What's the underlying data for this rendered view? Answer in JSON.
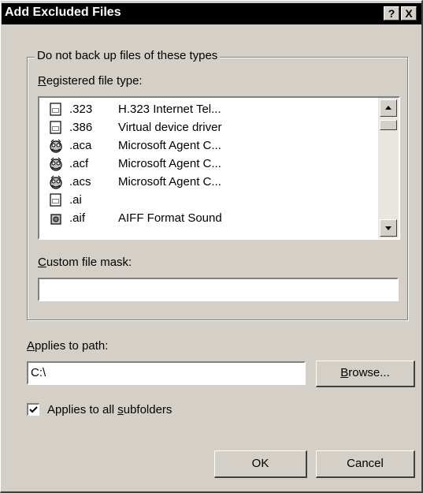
{
  "window": {
    "title": "Add Excluded Files",
    "help_label": "?",
    "close_label": "X"
  },
  "group": {
    "label": "Do not back up files of these types"
  },
  "registered": {
    "label_prefix": "",
    "label_accel": "R",
    "label_rest": "egistered file type:",
    "items": [
      {
        "ext": ".323",
        "desc": "H.323 Internet Tel...",
        "icon": "document-icon"
      },
      {
        "ext": ".386",
        "desc": "Virtual device driver",
        "icon": "document-icon"
      },
      {
        "ext": ".aca",
        "desc": "Microsoft Agent C...",
        "icon": "agent-icon"
      },
      {
        "ext": ".acf",
        "desc": "Microsoft Agent C...",
        "icon": "agent-icon"
      },
      {
        "ext": ".acs",
        "desc": "Microsoft Agent C...",
        "icon": "agent-icon"
      },
      {
        "ext": ".ai",
        "desc": "",
        "icon": "document-icon"
      },
      {
        "ext": ".aif",
        "desc": "AIFF Format Sound",
        "icon": "sound-icon"
      }
    ]
  },
  "custom_mask": {
    "label_accel": "C",
    "label_rest": "ustom file mask:",
    "value": ""
  },
  "path": {
    "label_accel": "A",
    "label_rest": "pplies to path:",
    "value": "C:\\"
  },
  "browse": {
    "accel": "B",
    "rest": "rowse..."
  },
  "subfolders": {
    "label_prefix": "Applies to all ",
    "label_accel": "s",
    "label_rest": "ubfolders",
    "checked": true
  },
  "ok_label": "OK",
  "cancel_label": "Cancel"
}
